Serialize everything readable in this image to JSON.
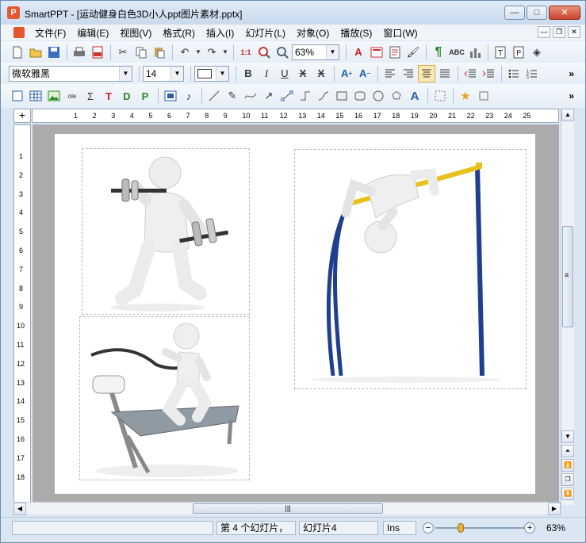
{
  "window": {
    "title": "SmartPPT - [运动健身白色3D小人ppt图片素材.pptx]",
    "controls": {
      "minimize": "—",
      "maximize": "□",
      "close": "✕"
    }
  },
  "menu": [
    "文件(F)",
    "编辑(E)",
    "视图(V)",
    "格式(R)",
    "插入(I)",
    "幻灯片(L)",
    "对象(O)",
    "播放(S)",
    "窗口(W)"
  ],
  "toolbar": {
    "zoom_value": "63%",
    "font_name": "微软雅黑",
    "font_size": "14",
    "more": "»"
  },
  "ruler": {
    "h_labels": [
      "1",
      "2",
      "3",
      "4",
      "5",
      "6",
      "7",
      "8",
      "9",
      "10",
      "11",
      "12",
      "13",
      "14",
      "15",
      "16",
      "17",
      "18",
      "19",
      "20",
      "21",
      "22",
      "23",
      "24",
      "25"
    ],
    "v_labels": [
      "1",
      "2",
      "3",
      "4",
      "5",
      "6",
      "7",
      "8",
      "9",
      "10",
      "11",
      "12",
      "13",
      "14",
      "15",
      "16",
      "17",
      "18"
    ]
  },
  "slide": {
    "images": [
      "fitness-3d-figure-dumbbells",
      "fitness-3d-figure-high-jump",
      "fitness-3d-figure-treadmill"
    ]
  },
  "scrollbar": {
    "hthumb_grip": "|||",
    "vthumb_grip": "≡"
  },
  "statusbar": {
    "slide_index": "第 4 个幻灯片，",
    "slide_name": "幻灯片4",
    "mode": "Ins",
    "zoom_minus": "−",
    "zoom_plus": "+",
    "zoom_percent": "63%"
  }
}
